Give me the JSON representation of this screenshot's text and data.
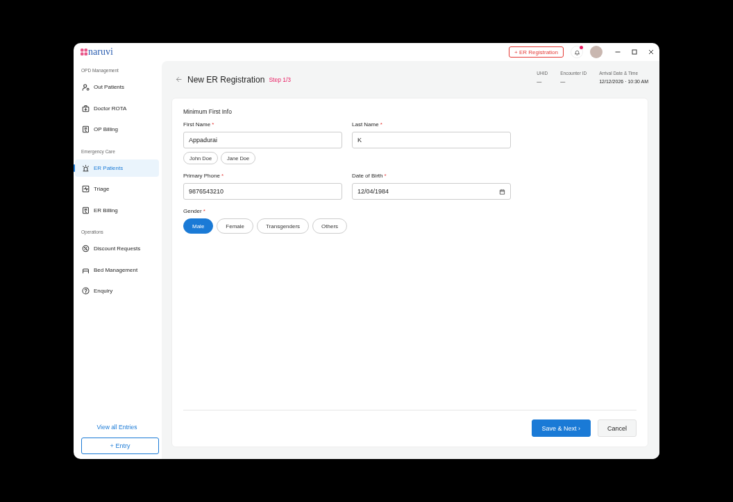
{
  "logo": {
    "text": "naruvi"
  },
  "topbar": {
    "action_button": {
      "icon": "+",
      "label": "ER Registration"
    },
    "notification": {
      "unread": true
    }
  },
  "sidebar": {
    "groups": [
      {
        "title": "OPD Management",
        "items": [
          {
            "label": "Out Patients",
            "kind": "person",
            "selected": false
          },
          {
            "label": "Doctor ROTA",
            "kind": "kit",
            "selected": false
          },
          {
            "label": "OP Billing",
            "kind": "bill",
            "selected": false
          }
        ]
      },
      {
        "title": "Emergency Care",
        "items": [
          {
            "label": "ER Patients",
            "kind": "siren",
            "selected": true
          },
          {
            "label": "Triage",
            "kind": "triage",
            "selected": false
          },
          {
            "label": "ER Billing",
            "kind": "bill",
            "selected": false
          }
        ]
      },
      {
        "title": "Operations",
        "items": [
          {
            "label": "Discount Requests",
            "kind": "discount",
            "selected": false
          },
          {
            "label": "Bed Management",
            "kind": "bed",
            "selected": false
          },
          {
            "label": "Enquiry",
            "kind": "help",
            "selected": false
          }
        ]
      }
    ],
    "view_all_link": "View all Entries",
    "entry_button": {
      "icon": "+",
      "label": "Entry"
    }
  },
  "header": {
    "title": "New ER Registration",
    "step": "Step 1/3",
    "meta": [
      {
        "label": "UHID",
        "value": "—"
      },
      {
        "label": "Encounter ID",
        "value": "—"
      },
      {
        "label": "Arrival Date & Time",
        "value": "12/12/2026 · 10:30 AM"
      }
    ]
  },
  "form": {
    "section_title": "Minimum First Info",
    "fields": [
      {
        "label": "First Name",
        "required": "*",
        "value": "Appadurai",
        "kind": "text",
        "suggestions": [
          "John Doe",
          "Jane Doe"
        ]
      },
      {
        "label": "Last Name",
        "required": "*",
        "value": "K",
        "kind": "text"
      },
      {
        "label": "Primary Phone",
        "required": "*",
        "value": "9876543210",
        "kind": "text"
      },
      {
        "label": "Date of Birth",
        "required": "*",
        "value": "12/04/1984",
        "kind": "date"
      }
    ],
    "gender": {
      "label": "Gender",
      "required": "*",
      "options": [
        {
          "label": "Male",
          "selected": true
        },
        {
          "label": "Female",
          "selected": false
        },
        {
          "label": "Transgenders",
          "selected": false
        },
        {
          "label": "Others",
          "selected": false
        }
      ]
    },
    "buttons": [
      {
        "label": "Save & Next",
        "icon": "›",
        "kind": "primary"
      },
      {
        "label": "Cancel",
        "kind": "secondary"
      }
    ]
  }
}
